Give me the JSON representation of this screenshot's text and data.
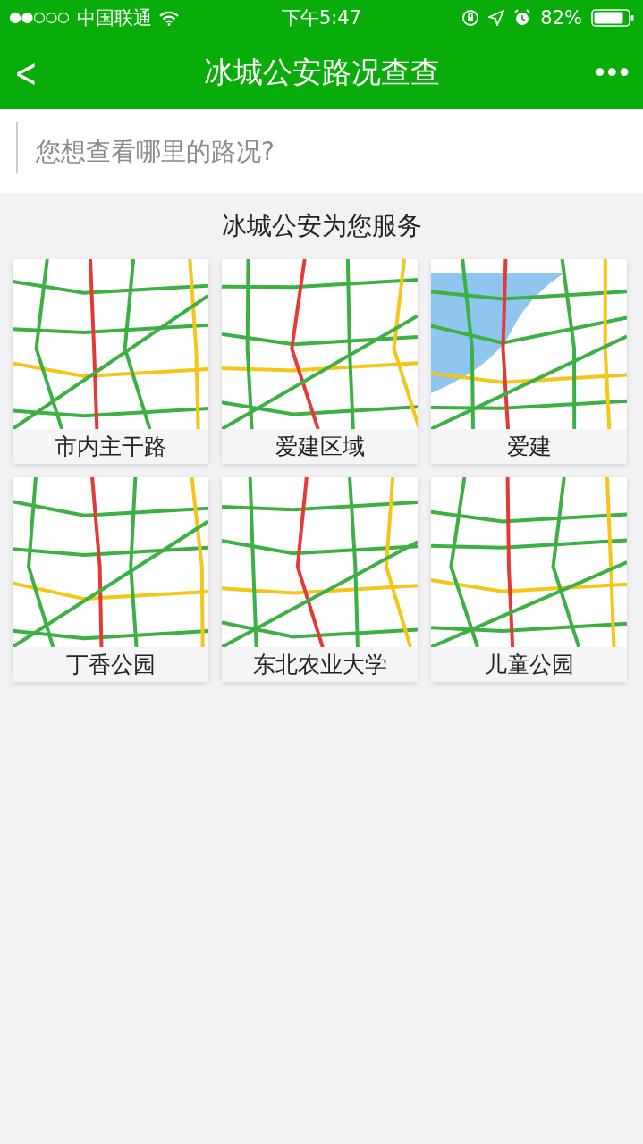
{
  "status_bar": {
    "carrier": "中国联通",
    "time": "下午5:47",
    "battery": "82%"
  },
  "nav_bar": {
    "back": "<",
    "title": "冰城公安路况查查",
    "more": "•••"
  },
  "search": {
    "placeholder": "您想查看哪里的路况?"
  },
  "section_title": "冰城公安为您服务",
  "tiles": [
    {
      "label": "市内主干路"
    },
    {
      "label": "爱建区域"
    },
    {
      "label": "爱建"
    },
    {
      "label": "丁香公园"
    },
    {
      "label": "东北农业大学"
    },
    {
      "label": "儿童公园"
    }
  ]
}
